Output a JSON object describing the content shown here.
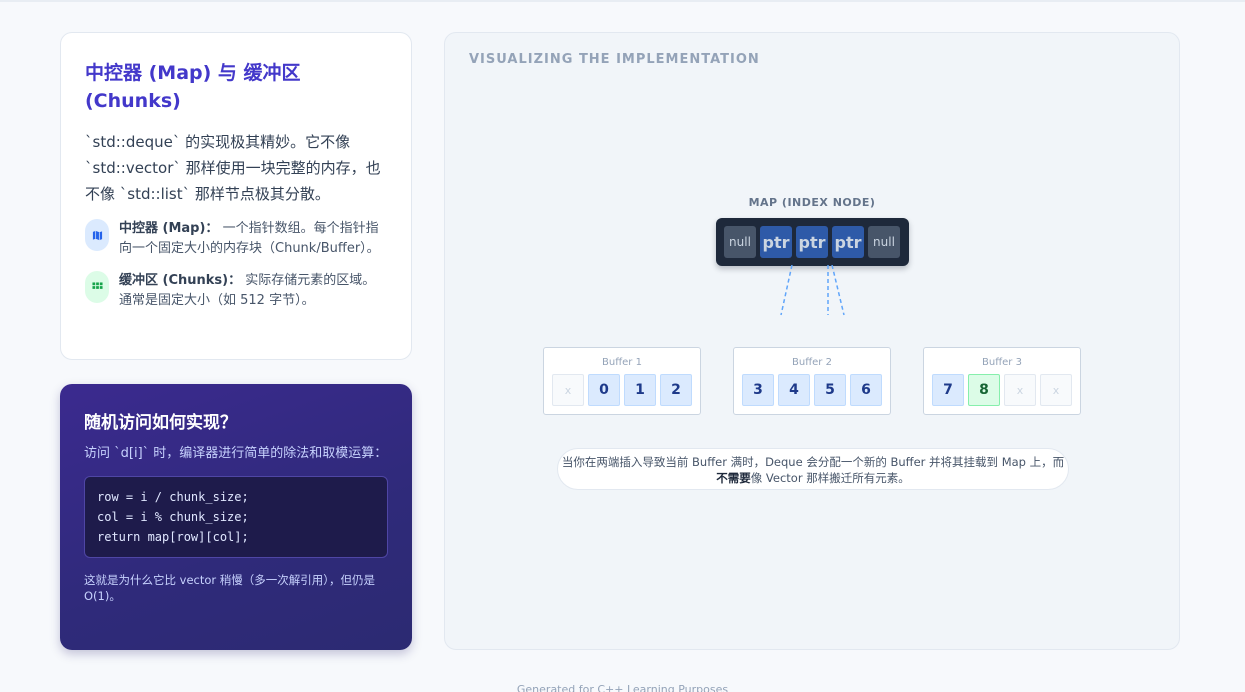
{
  "info": {
    "title": "中控器 (Map) 与 缓冲区 (Chunks)",
    "desc": "`std::deque` 的实现极其精妙。它不像 `std::vector` 那样使用一块完整的内存，也不像 `std::list` 那样节点极其分散。",
    "bullets": [
      {
        "icon": "map-icon",
        "term": "中控器 (Map)：",
        "text": " 一个指针数组。每个指针指向一个固定大小的内存块（Chunk/Buffer）。"
      },
      {
        "icon": "grid-icon",
        "term": "缓冲区 (Chunks)：",
        "text": " 实际存储元素的区域。通常是固定大小（如 512 字节）。"
      }
    ]
  },
  "random_access": {
    "title": "随机访问如何实现？",
    "desc": "访问 `d[i]` 时，编译器进行简单的除法和取模运算：",
    "code": [
      "row = i / chunk_size;",
      "col = i % chunk_size;",
      "return map[row][col];"
    ],
    "note": "这就是为什么它比 vector 稍慢（多一次解引用），但仍是 O(1)。"
  },
  "viz": {
    "heading": "VISUALIZING THE IMPLEMENTATION",
    "map_label": "MAP (INDEX NODE)",
    "map_cells": [
      "null",
      "ptr",
      "ptr",
      "ptr",
      "null"
    ],
    "buffers": [
      {
        "label": "Buffer 1",
        "cells": [
          "x",
          "0",
          "1",
          "2"
        ]
      },
      {
        "label": "Buffer 2",
        "cells": [
          "3",
          "4",
          "5",
          "6"
        ]
      },
      {
        "label": "Buffer 3",
        "cells": [
          "7",
          "8",
          "x",
          "x"
        ]
      }
    ],
    "note_before": "当你在两端插入导致当前 Buffer 满时，Deque 会分配一个新的 Buffer 并将其挂载到 Map 上，而",
    "note_bold": "不需要",
    "note_after": "像 Vector 那样搬迁所有元素。"
  },
  "footer": "Generated for C++ Learning Purposes",
  "colors": {
    "accent": "#4338ca",
    "purple_card": "#2f2a7a",
    "map_bg": "#1e293b",
    "ptr_cell": "#2e5aa8",
    "value_cell": "#dbeafe",
    "new_cell": "#dcfce7"
  }
}
